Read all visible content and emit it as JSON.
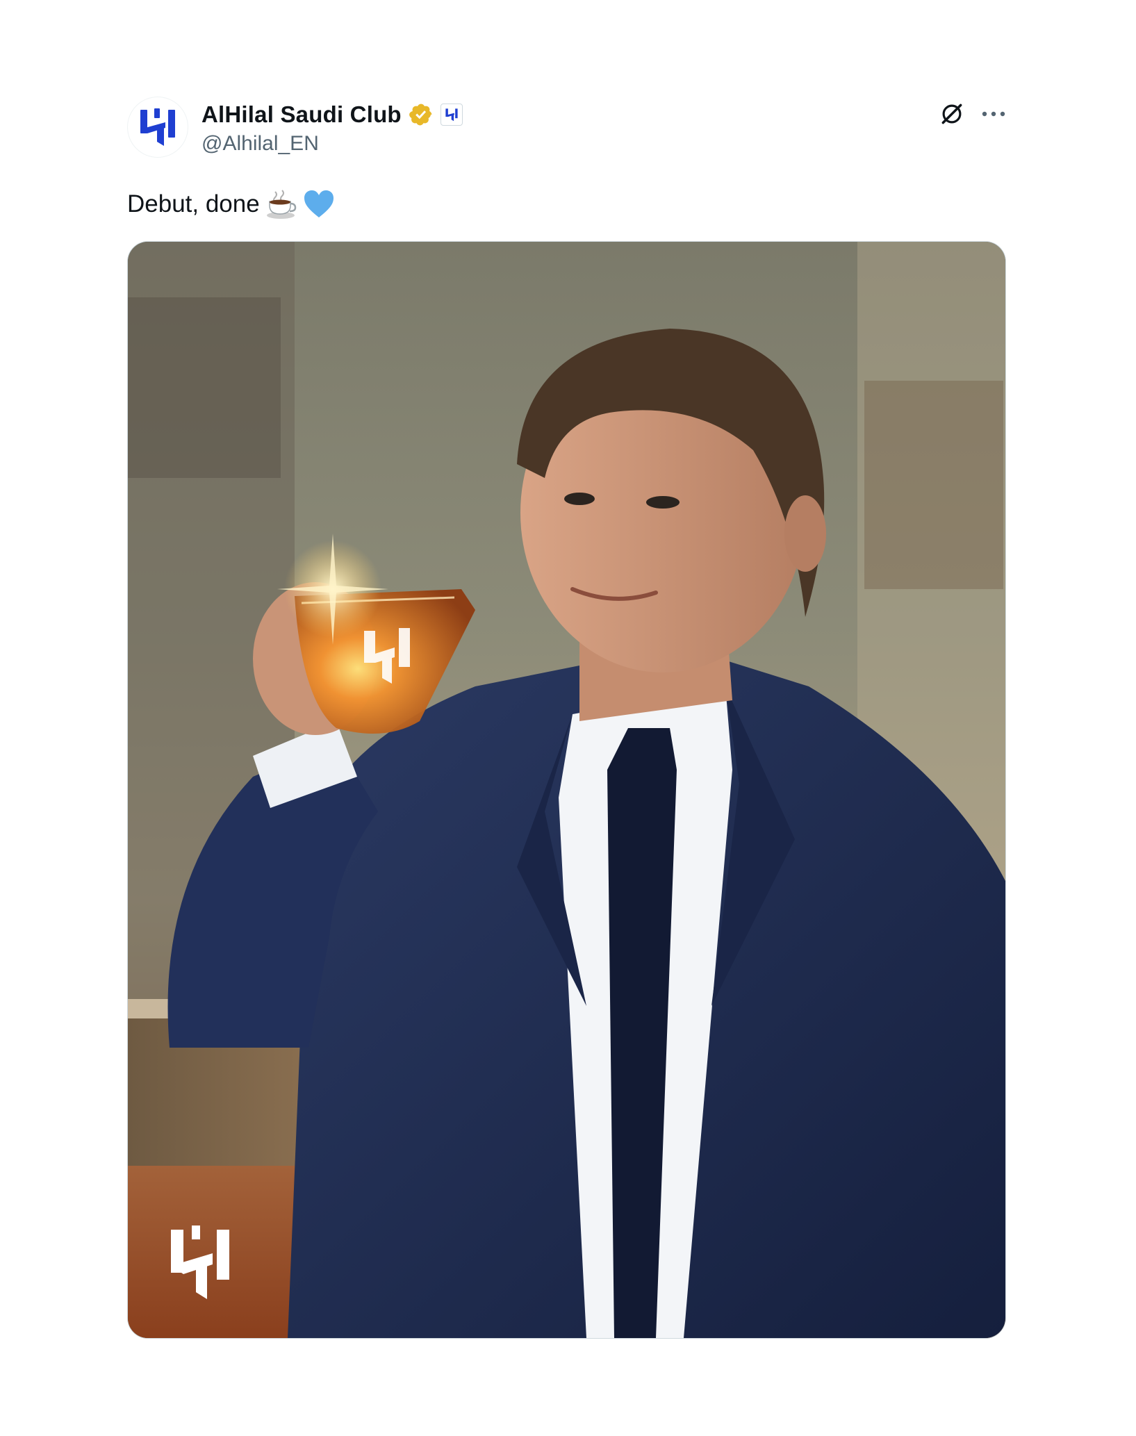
{
  "tweet": {
    "author": {
      "display_name": "AlHilal Saudi Club",
      "handle": "@Alhilal_EN",
      "verified": true,
      "verified_badge_color": "#e8b829",
      "brand_color": "#1f3fd1",
      "avatar_icon": "alhilal-logo-icon",
      "affiliate_icon": "alhilal-badge-icon"
    },
    "text": "Debut, done",
    "emojis": [
      "coffee-cup-icon",
      "blue-heart-icon"
    ],
    "actions": {
      "grok_icon": "grok-icon",
      "more_icon": "more-options-icon"
    },
    "media": {
      "type": "photo",
      "watermark_icon": "alhilal-logo-icon"
    }
  }
}
